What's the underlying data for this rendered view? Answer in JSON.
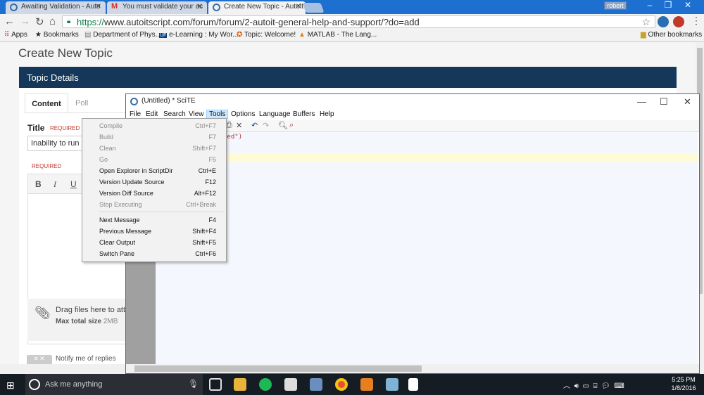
{
  "browser": {
    "tabs": [
      {
        "title": "Awaiting Validation - Auto",
        "active": false
      },
      {
        "title": "You must validate your ac",
        "active": false
      },
      {
        "title": "Create New Topic - AutoIt",
        "active": true
      }
    ],
    "user_badge": "robert",
    "url_scheme": "https://",
    "url_rest": "www.autoitscript.com/forum/forum/2-autoit-general-help-and-support/?do=add",
    "bookmarks": [
      {
        "label": "Apps"
      },
      {
        "label": "Bookmarks"
      },
      {
        "label": "Department of Phys..."
      },
      {
        "label": "e-Learning : My Wor..."
      },
      {
        "label": "Topic: Welcome!"
      },
      {
        "label": "MATLAB - The Lang..."
      }
    ],
    "other_bookmarks": "Other bookmarks"
  },
  "page": {
    "title": "Create New Topic",
    "topic_details": "Topic Details",
    "tabs": [
      "Content",
      "Poll"
    ],
    "title_label": "Title",
    "required": "REQUIRED",
    "title_value": "Inability to run a",
    "editor_buttons": [
      "B",
      "I",
      "U"
    ],
    "drag_text": "Drag files here to att",
    "max_size_label": "Max total size",
    "max_size_value": "2MB",
    "notify_label": "Notify me of replies"
  },
  "scite": {
    "title": "(Untitled) * SciTE",
    "menus": [
      "File",
      "Edit",
      "Search",
      "View",
      "Tools",
      "Options",
      "Language",
      "Buffers",
      "Help"
    ],
    "open_menu": "Tools",
    "code_fragment": "ted\")",
    "tools_menu": [
      {
        "label": "Compile",
        "shortcut": "Ctrl+F7",
        "enabled": false
      },
      {
        "label": "Build",
        "shortcut": "F7",
        "enabled": false
      },
      {
        "label": "Clean",
        "shortcut": "Shift+F7",
        "enabled": false
      },
      {
        "label": "Go",
        "shortcut": "F5",
        "enabled": false
      },
      {
        "label": "Open Explorer in ScriptDir",
        "shortcut": "Ctrl+E",
        "enabled": true
      },
      {
        "label": "Version Update Source",
        "shortcut": "F12",
        "enabled": true
      },
      {
        "label": "Version Diff Source",
        "shortcut": "Alt+F12",
        "enabled": true
      },
      {
        "label": "Stop Executing",
        "shortcut": "Ctrl+Break",
        "enabled": false
      },
      {
        "label": "Next Message",
        "shortcut": "F4",
        "enabled": true
      },
      {
        "label": "Previous Message",
        "shortcut": "Shift+F4",
        "enabled": true
      },
      {
        "label": "Clear Output",
        "shortcut": "Shift+F5",
        "enabled": true
      },
      {
        "label": "Switch Pane",
        "shortcut": "Ctrl+F6",
        "enabled": true
      }
    ]
  },
  "taskbar": {
    "search_placeholder": "Ask me anything",
    "time": "5:25 PM",
    "date": "1/8/2016"
  }
}
